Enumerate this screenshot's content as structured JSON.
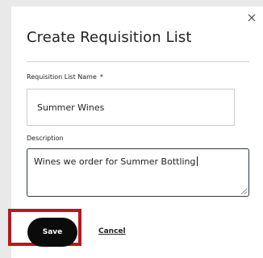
{
  "dialog": {
    "title": "Create Requisition List",
    "close_icon": "close-icon"
  },
  "form": {
    "name_label": "Requisition List Name",
    "required_marker": "*",
    "name_value": "Summer Wines",
    "description_label": "Description",
    "description_value": "Wines we order for Summer Bottling"
  },
  "actions": {
    "save_label": "Save",
    "cancel_label": "Cancel"
  },
  "colors": {
    "save_button_bg": "#0b0b0b",
    "highlight_border": "#c0141b",
    "focused_border": "#2a3a4a"
  }
}
